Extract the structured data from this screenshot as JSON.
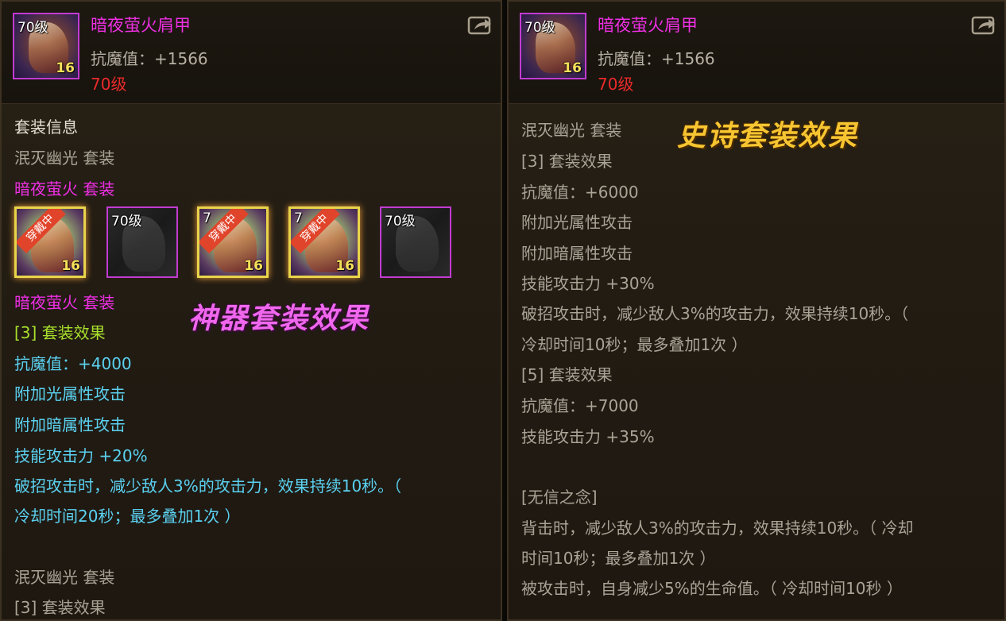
{
  "left_panel": {
    "item": {
      "name": "暗夜萤火肩甲",
      "level_badge": "70级",
      "upgrade": "16",
      "stat": "抗魔值：+1566",
      "requirement": "70级"
    },
    "section_title": "套装信息",
    "lines_top": {
      "set1": "泯灭幽光  套装",
      "set2": "暗夜萤火  套装"
    },
    "slots": [
      {
        "state": "equipped",
        "level_badge": "",
        "ribbon": "穿戴中",
        "upgrade": "16"
      },
      {
        "state": "empty",
        "level_badge": "70级",
        "ribbon": "",
        "upgrade": ""
      },
      {
        "state": "equipped",
        "level_badge": "7",
        "ribbon": "穿戴中",
        "upgrade": "16"
      },
      {
        "state": "equipped",
        "level_badge": "7",
        "ribbon": "穿戴中",
        "upgrade": "16"
      },
      {
        "state": "empty",
        "level_badge": "70级",
        "ribbon": "",
        "upgrade": ""
      }
    ],
    "overlay_title": "神器套装效果",
    "lines_bottom": {
      "set_name": "暗夜萤火  套装",
      "bonus_header": "[3] 套装效果",
      "magic_def": "抗魔值：+4000",
      "light_atk": "附加光属性攻击",
      "dark_atk": "附加暗属性攻击",
      "skill_atk": "技能攻击力 +20%",
      "desc1": "破招攻击时，减少敌人3%的攻击力，效果持续10秒。（",
      "desc2": "冷却时间20秒；最多叠加1次 ）",
      "set_name2": "泯灭幽光  套装",
      "bonus_header2": "[3] 套装效果"
    }
  },
  "right_panel": {
    "item": {
      "name": "暗夜萤火肩甲",
      "level_badge": "70级",
      "upgrade": "16",
      "stat": "抗魔值：+1566",
      "requirement": "70级"
    },
    "overlay_title": "史诗套装效果",
    "lines": {
      "set_name": "泯灭幽光  套装",
      "bonus3": "[3] 套装效果",
      "magic_def3": "抗魔值：+6000",
      "light_atk": "附加光属性攻击",
      "dark_atk": "附加暗属性攻击",
      "skill_atk3": "技能攻击力 +30%",
      "desc1": "破招攻击时，减少敌人3%的攻击力，效果持续10秒。（",
      "desc2": "冷却时间10秒；最多叠加1次 ）",
      "bonus5": "[5] 套装效果",
      "magic_def5": "抗魔值：+7000",
      "skill_atk5": "技能攻击力 +35%",
      "trait_name": "[无信之念]",
      "trait1": "背击时，减少敌人3%的攻击力，效果持续10秒。（ 冷却",
      "trait2": "时间10秒；最多叠加1次 ）",
      "trait3": "被攻击时，自身减少5%的生命值。（ 冷却时间10秒 ）"
    }
  },
  "colors": {
    "item_name": "#ee2fe3",
    "requirement": "#ea2a2a",
    "bonus_green": "#a9e02c",
    "bonus_cyan": "#5bd1f0",
    "gold_overlay": "#f7c531",
    "pink_overlay": "#f067ee"
  },
  "icons": [
    "share-icon",
    "shoulder-armor-icon"
  ]
}
